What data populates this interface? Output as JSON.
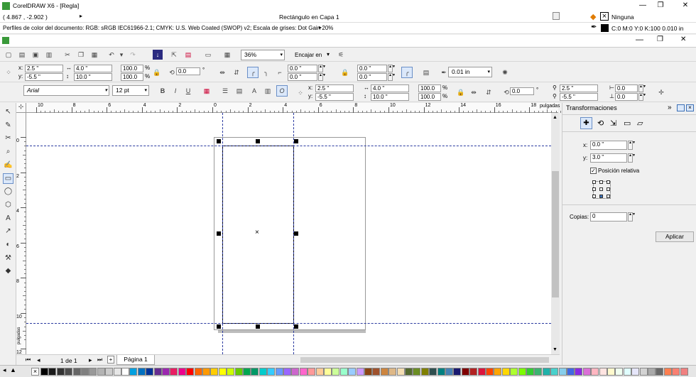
{
  "window": {
    "title": "CorelDRAW X6 - [Regla]",
    "min_glyph": "—",
    "max_glyph": "❐",
    "close_glyph": "✕"
  },
  "status": {
    "coords": "( 4.867 , -2.902 )",
    "object_info": "Rectángulo en Capa 1",
    "color_profiles": "Perfiles de color del documento: RGB: sRGB IEC61966-2.1; CMYK: U.S. Web Coated (SWOP) v2; Escala de grises: Dot Gain 20%",
    "fill_label": "Ninguna",
    "outline_label": "C:0 M:0 Y:0 K:100  0.010 in"
  },
  "std_toolbar": {
    "zoom": "36%",
    "snap_label": "Encajar en"
  },
  "property_bar": {
    "x": "2.5 \"",
    "y": "-5.5 \"",
    "width": "4.0 \"",
    "height": "10.0 \"",
    "scale_w": "100.0",
    "scale_h": "100.0",
    "percent": "%",
    "rotation": "0.0",
    "degree": "°",
    "corner_tl": "0.0 \"",
    "corner_bl": "0.0 \"",
    "corner_tr": "0.0 \"",
    "corner_br": "0.0 \"",
    "outline_width": "0.01 in"
  },
  "text_bar": {
    "font": "Arial",
    "size": "12 pt",
    "x": "2.5 \"",
    "y": "-5.5 \"",
    "width": "4.0 \"",
    "height": "10.0 \"",
    "scale_w": "100.0",
    "scale_h": "100.0",
    "percent": "%",
    "rotation": "0.0",
    "degree": "°",
    "pos_x": "2.5 \"",
    "pos_y": "-5.5 \"",
    "skew_h": "0.0",
    "skew_v": "0.0"
  },
  "ruler": {
    "h_labels": [
      "10",
      "8",
      "6",
      "4",
      "2",
      "0",
      "2",
      "4",
      "6",
      "8",
      "10",
      "12",
      "14",
      "16",
      "18"
    ],
    "v_labels": [
      "0",
      "2",
      "4",
      "6",
      "8",
      "10",
      "12"
    ],
    "unit": "pulgadas"
  },
  "docker": {
    "title": "Transformaciones",
    "x_label": "x:",
    "x_value": "0.0 \"",
    "y_label": "y:",
    "y_value": "3.0 \"",
    "relative_label": "Posición relativa",
    "copies_label": "Copias:",
    "copies_value": "0",
    "apply_label": "Aplicar"
  },
  "pages": {
    "count_label": "1 de 1",
    "tab_label": "Página 1"
  },
  "icons": {
    "close": "×",
    "dropdown": "▾",
    "menu_arrow": "▸",
    "spin_up": "▲",
    "spin_down": "▼",
    "expand": "»",
    "nav_first": "⏮",
    "nav_prev": "◂",
    "nav_next": "▸",
    "nav_last": "⏭",
    "add_page": "+",
    "move": "✚",
    "rotate": "⟲",
    "scale": "⇲",
    "size": "▭",
    "skew": "▱",
    "tools": [
      "↖",
      "✎",
      "✂",
      "⌕",
      "✍",
      "▭",
      "◯",
      "⬡",
      "A",
      "↗",
      "◐",
      "⚒",
      "◆"
    ]
  },
  "palette_colors": [
    "#000000",
    "#1a1a1a",
    "#333333",
    "#4d4d4d",
    "#666666",
    "#808080",
    "#999999",
    "#b3b3b3",
    "#cccccc",
    "#e6e6e6",
    "#ffffff",
    "#00a0e0",
    "#0070c0",
    "#003399",
    "#662d91",
    "#9c27b0",
    "#e91e63",
    "#ec008c",
    "#ff0000",
    "#ff6600",
    "#ff9900",
    "#ffcc00",
    "#ffff00",
    "#ccff00",
    "#66cc00",
    "#00a651",
    "#009966",
    "#00cccc",
    "#33ccff",
    "#6699ff",
    "#9966ff",
    "#cc66cc",
    "#ff66cc",
    "#ff9999",
    "#ffcc99",
    "#ffff99",
    "#ccff99",
    "#99ffcc",
    "#99ccff",
    "#cc99ff",
    "#8b4513",
    "#a0522d",
    "#cd853f",
    "#deb887",
    "#f5deb3",
    "#556b2f",
    "#6b8e23",
    "#808000",
    "#2f4f4f",
    "#008080",
    "#4682b4",
    "#191970",
    "#800000",
    "#b22222",
    "#dc143c",
    "#ff4500",
    "#ffa500",
    "#ffd700",
    "#adff2f",
    "#7cfc00",
    "#32cd32",
    "#3cb371",
    "#20b2aa",
    "#48d1cc",
    "#87ceeb",
    "#4169e1",
    "#8a2be2",
    "#da70d6",
    "#ffb6c1",
    "#ffe4e1",
    "#fffacd",
    "#f0fff0",
    "#e0ffff",
    "#e6e6fa",
    "#d3d3d3",
    "#a9a9a9",
    "#696969",
    "#ff7f50",
    "#fa8072",
    "#f08080"
  ]
}
